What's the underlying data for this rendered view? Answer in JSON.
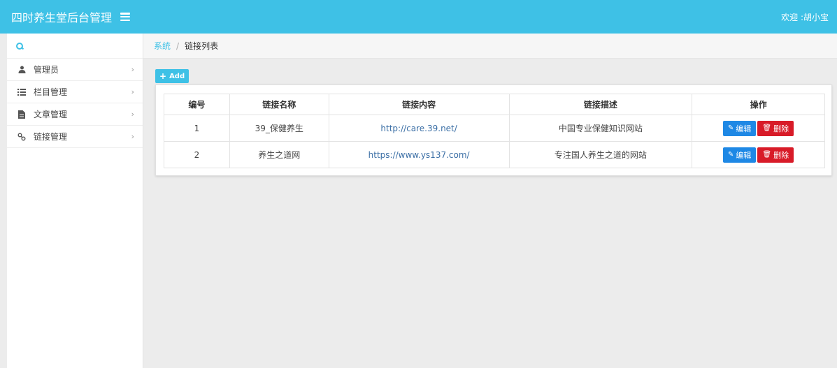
{
  "app": {
    "title": "四时养生堂后台管理",
    "welcome": "欢迎 :胡小宝"
  },
  "sidebar": {
    "items": [
      {
        "label": "管理员",
        "icon": "user-icon"
      },
      {
        "label": "栏目管理",
        "icon": "list-icon"
      },
      {
        "label": "文章管理",
        "icon": "file-icon"
      },
      {
        "label": "链接管理",
        "icon": "link-icon"
      }
    ]
  },
  "breadcrumb": {
    "parent": "系统",
    "separator": "/",
    "current": "链接列表"
  },
  "toolbar": {
    "add_label": "Add"
  },
  "table": {
    "headers": [
      "编号",
      "链接名称",
      "链接内容",
      "链接描述",
      "操作"
    ],
    "rows": [
      {
        "id": "1",
        "name": "39_保健养生",
        "url": "http://care.39.net/",
        "desc": "中国专业保健知识网站",
        "edit": "编辑",
        "delete": "删除"
      },
      {
        "id": "2",
        "name": "养生之道网",
        "url": "https://www.ys137.com/",
        "desc": "专注国人养生之道的网站",
        "edit": "编辑",
        "delete": "删除"
      }
    ]
  },
  "colors": {
    "accent": "#3ec1e6",
    "edit": "#1e88e5",
    "delete": "#d81b28"
  }
}
